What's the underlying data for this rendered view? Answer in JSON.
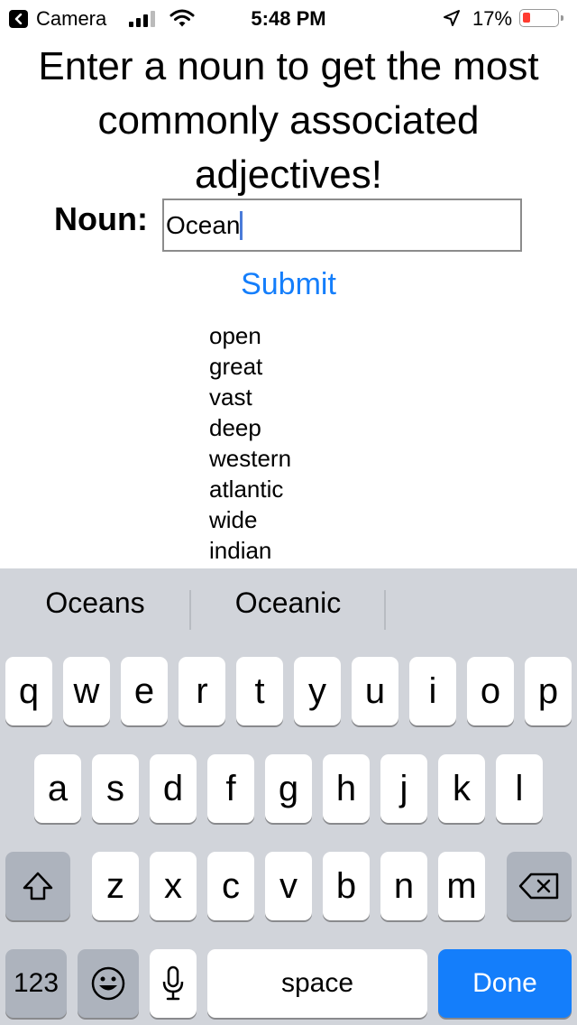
{
  "status": {
    "back_label": "Camera",
    "time": "5:48 PM",
    "battery": "17%"
  },
  "heading": "Enter a noun to get the most commonly associated adjectives!",
  "form": {
    "noun_label": "Noun:",
    "noun_value": "Ocean",
    "submit_label": "Submit"
  },
  "results": [
    "open",
    "great",
    "vast",
    "deep",
    "western",
    "atlantic",
    "wide",
    "indian"
  ],
  "keyboard": {
    "suggestions": [
      "Oceans",
      "Oceanic",
      ""
    ],
    "row1": [
      "q",
      "w",
      "e",
      "r",
      "t",
      "y",
      "u",
      "i",
      "o",
      "p"
    ],
    "row2": [
      "a",
      "s",
      "d",
      "f",
      "g",
      "h",
      "j",
      "k",
      "l"
    ],
    "row3": [
      "z",
      "x",
      "c",
      "v",
      "b",
      "n",
      "m"
    ],
    "numbers_label": "123",
    "space_label": "space",
    "done_label": "Done"
  },
  "colors": {
    "accent": "#147efb",
    "keyboard_bg": "#d1d4da",
    "battery_low": "#ff3b30"
  }
}
